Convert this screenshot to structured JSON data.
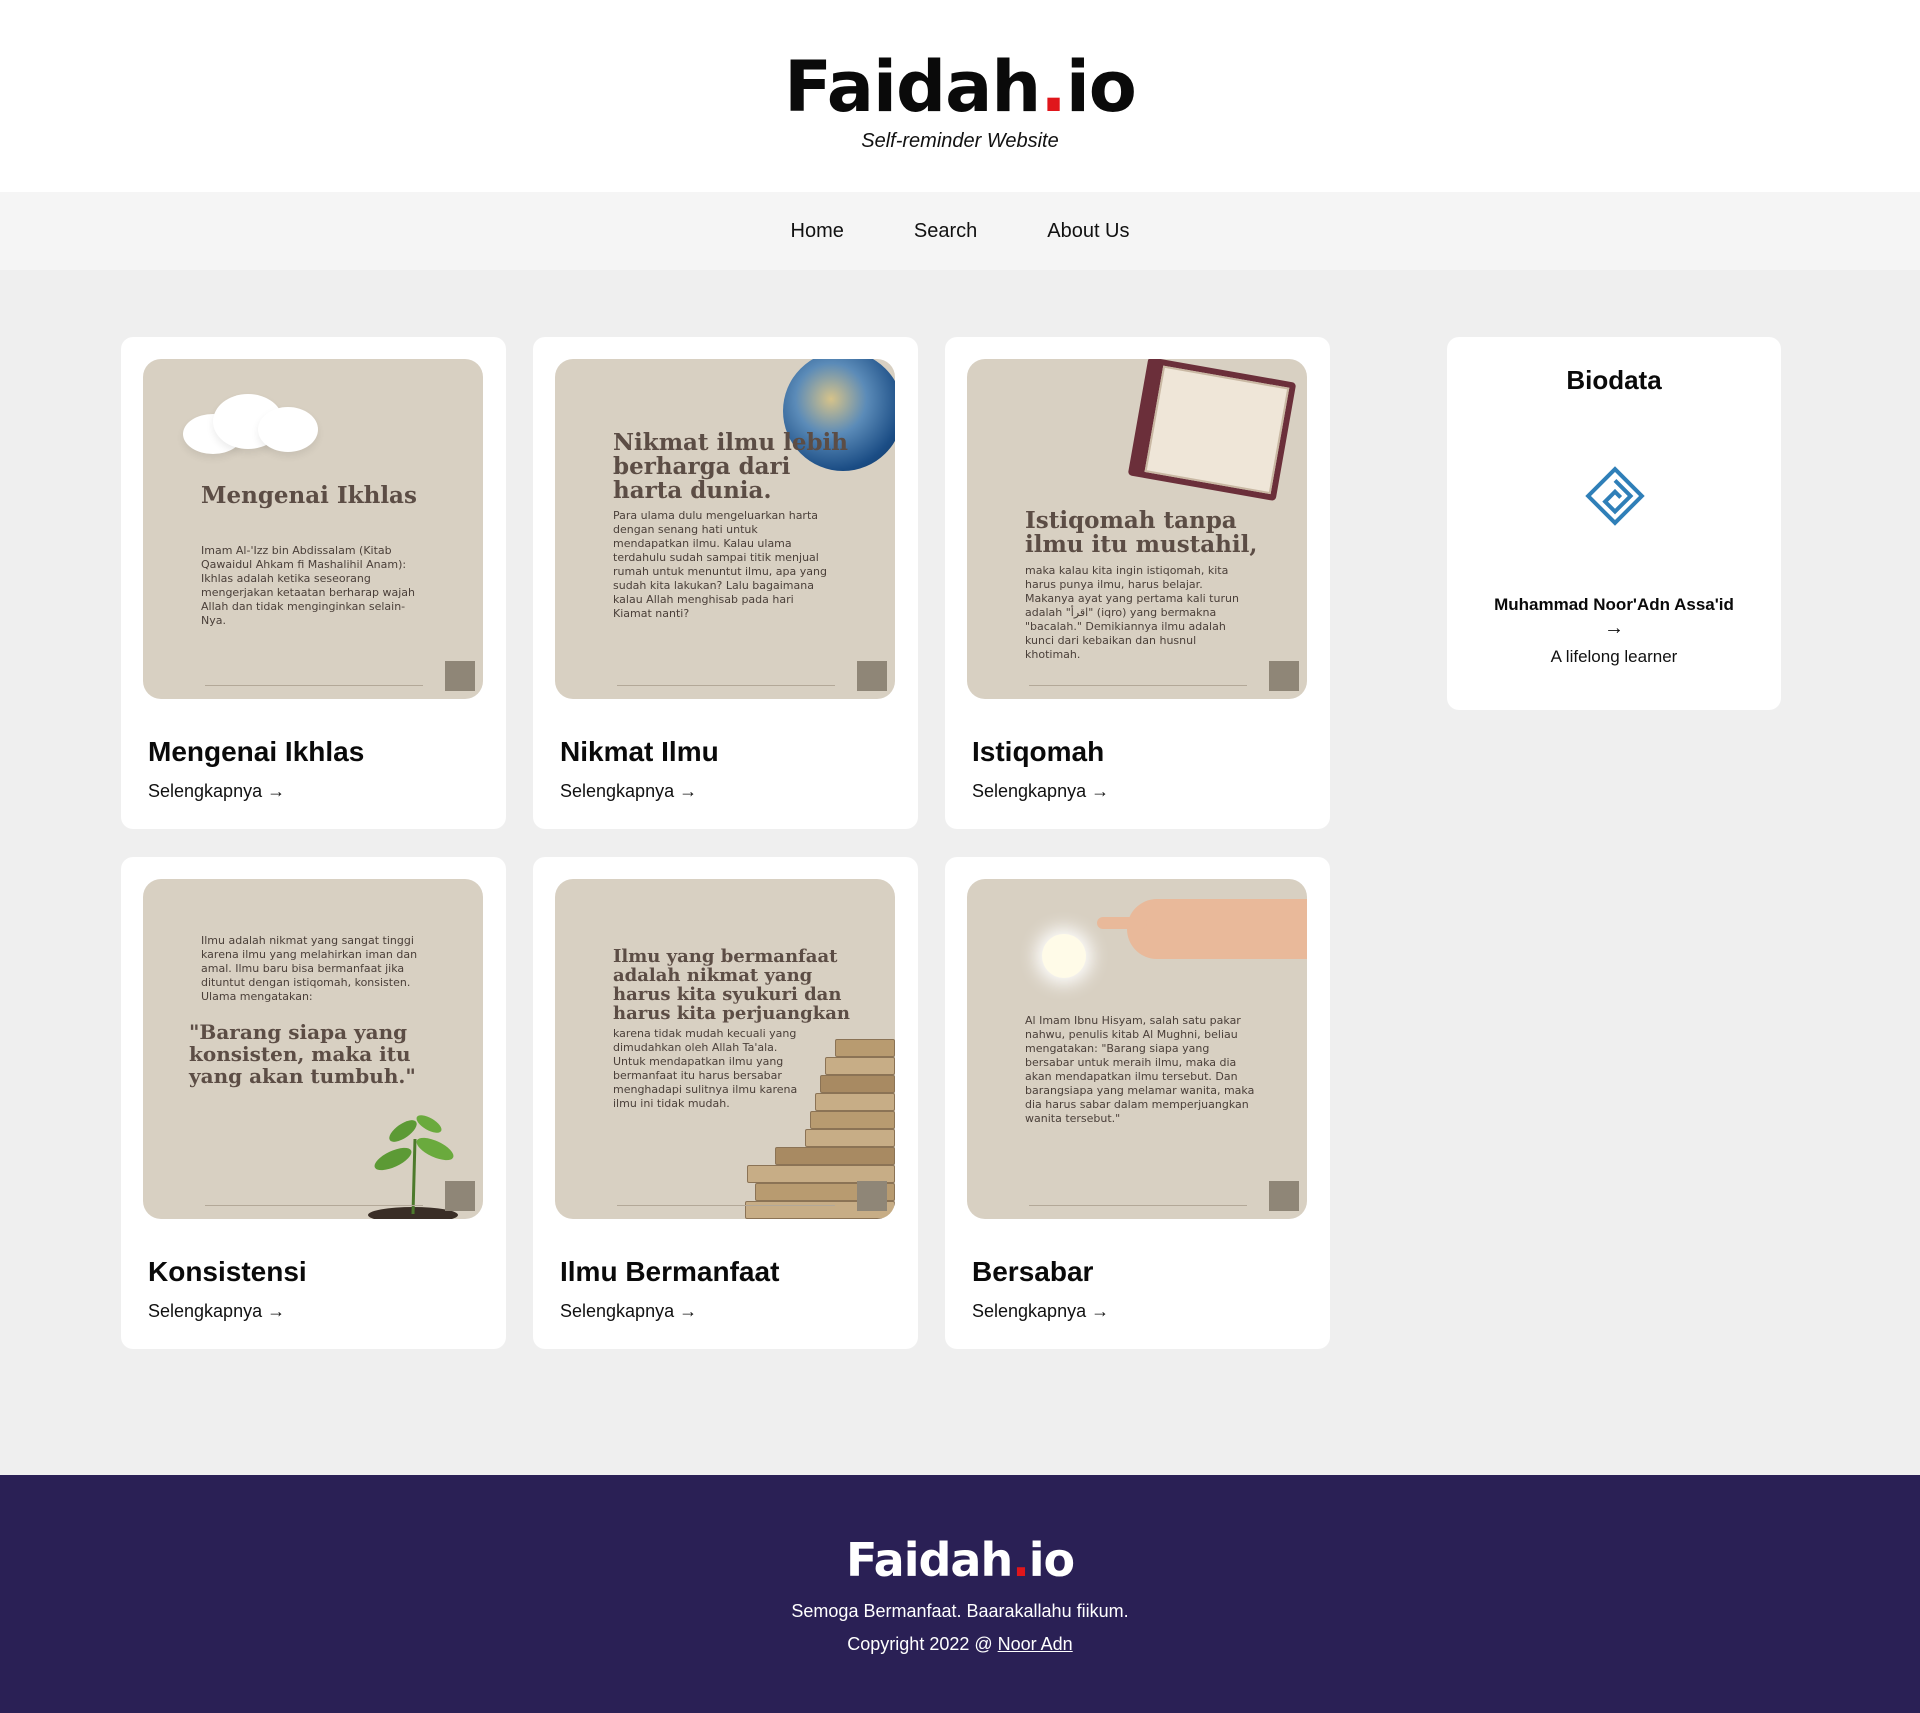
{
  "header": {
    "logo_main": "Faidah",
    "logo_dot": ".",
    "logo_tail": "io",
    "tagline": "Self-reminder Website"
  },
  "nav": {
    "items": [
      {
        "label": "Home"
      },
      {
        "label": "Search"
      },
      {
        "label": "About Us"
      }
    ]
  },
  "posts": [
    {
      "title": "Mengenai Ikhlas",
      "link": "Selengkapnya →",
      "image_heading": "Mengenai Ikhlas",
      "image_body": "Imam Al-'Izz bin Abdissalam (Kitab Qawaidul Ahkam fi Mashalihil Anam): Ikhlas adalah ketika seseorang mengerjakan ketaatan berharap wajah Allah dan tidak menginginkan selain-Nya."
    },
    {
      "title": "Nikmat Ilmu",
      "link": "Selengkapnya →",
      "image_heading": "Nikmat ilmu lebih berharga dari harta dunia.",
      "image_body": "Para ulama dulu mengeluarkan harta dengan senang hati untuk mendapatkan ilmu. Kalau ulama terdahulu sudah sampai titik menjual rumah untuk menuntut ilmu, apa yang sudah kita lakukan? Lalu bagaimana kalau Allah menghisab pada hari Kiamat nanti?"
    },
    {
      "title": "Istiqomah",
      "link": "Selengkapnya →",
      "image_heading": "Istiqomah tanpa ilmu itu mustahil,",
      "image_body": "maka kalau kita ingin istiqomah, kita harus punya ilmu, harus belajar. Makanya ayat yang pertama kali turun adalah \"اقرأ\" (iqro) yang bermakna \"bacalah.\" Demikiannya ilmu adalah kunci dari kebaikan dan husnul khotimah."
    },
    {
      "title": "Konsistensi",
      "link": "Selengkapnya →",
      "image_heading": "\"Barang siapa yang konsisten, maka itu yang akan tumbuh.\"",
      "image_body": "Ilmu adalah nikmat yang sangat tinggi karena ilmu yang melahirkan iman dan amal. Ilmu baru bisa bermanfaat jika dituntut dengan istiqomah, konsisten. Ulama mengatakan:"
    },
    {
      "title": "Ilmu Bermanfaat",
      "link": "Selengkapnya →",
      "image_heading": "Ilmu yang bermanfaat adalah nikmat yang harus kita syukuri dan harus kita perjuangkan",
      "image_body": "karena tidak mudah kecuali yang dimudahkan oleh Allah Ta'ala. Untuk mendapatkan ilmu yang bermanfaat itu harus bersabar menghadapi sulitnya ilmu karena ilmu ini tidak mudah."
    },
    {
      "title": "Bersabar",
      "link": "Selengkapnya →",
      "image_heading": "",
      "image_body": "Al Imam Ibnu Hisyam, salah satu pakar nahwu, penulis kitab Al Mughni, beliau mengatakan: \"Barang siapa yang bersabar untuk meraih ilmu, maka dia akan mendapatkan ilmu tersebut. Dan barangsiapa yang melamar wanita, maka dia harus sabar dalam memperjuangkan wanita tersebut.\""
    }
  ],
  "sidebar": {
    "title": "Biodata",
    "name": "Muhammad Noor'Adn Assa'id",
    "arrow": "→",
    "description": "A lifelong learner",
    "logo_icon": "kufic-square-logo-icon",
    "logo_color": "#2f7fb8"
  },
  "footer": {
    "logo_main": "Faidah",
    "logo_dot": ".",
    "logo_tail": "io",
    "line1": "Semoga Bermanfaat. Baarakallahu fiikum.",
    "copyright_prefix": "Copyright 2022 @ ",
    "author_link": "Noor Adn"
  },
  "colors": {
    "accent_dot": "#e0161b",
    "footer_bg": "#2a2055",
    "page_bg": "#efefef"
  }
}
